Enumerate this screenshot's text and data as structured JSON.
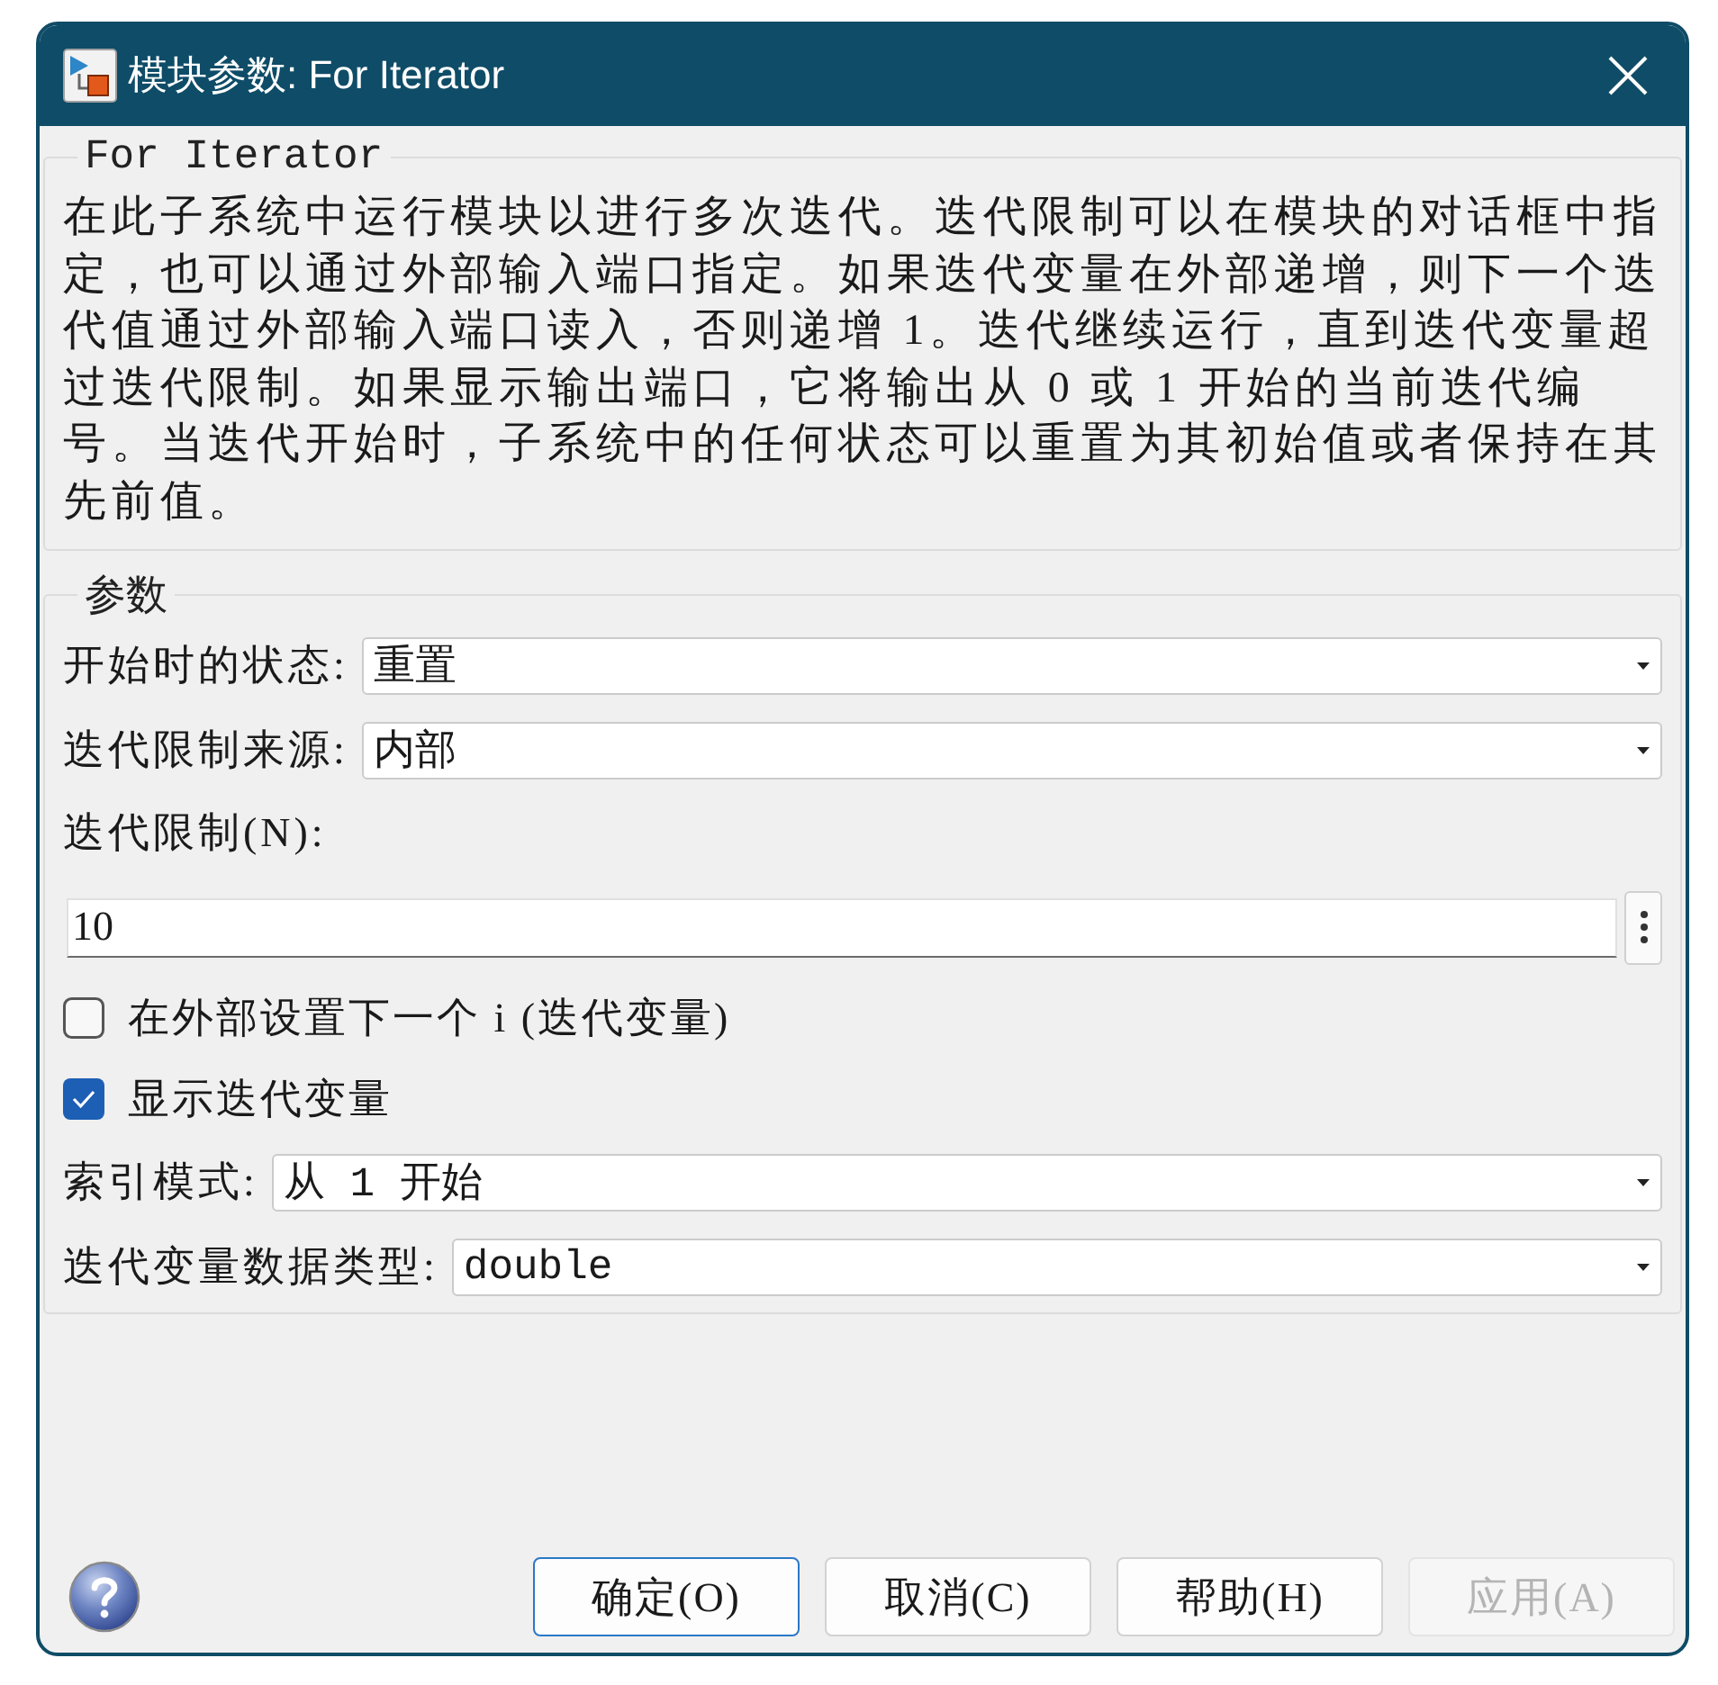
{
  "window": {
    "title": "模块参数: For Iterator"
  },
  "description": {
    "title": "For Iterator",
    "text": "在此子系统中运行模块以进行多次迭代。迭代限制可以在模块的对话框中指定，也可以通过外部输入端口指定。如果迭代变量在外部递增，则下一个迭代值通过外部输入端口读入，否则递增 1。迭代继续运行，直到迭代变量超过迭代限制。如果显示输出端口，它将输出从 0 或 1 开始的当前迭代编号。当迭代开始时，子系统中的任何状态可以重置为其初始值或者保持在其先前值。"
  },
  "parameters": {
    "title": "参数",
    "fields": [
      {
        "kind": "dropdown",
        "label": "开始时的状态:",
        "value": "重置"
      },
      {
        "kind": "dropdown",
        "label": "迭代限制来源:",
        "value": "内部"
      },
      {
        "kind": "text",
        "label": "迭代限制(N):",
        "value": "10"
      },
      {
        "kind": "checkbox",
        "label": "在外部设置下一个 i (迭代变量)",
        "checked": false
      },
      {
        "kind": "checkbox",
        "label": "显示迭代变量",
        "checked": true
      },
      {
        "kind": "dropdown",
        "label": "索引模式:",
        "value": "从 1 开始"
      },
      {
        "kind": "dropdown",
        "label": "迭代变量数据类型:",
        "value": "double"
      }
    ]
  },
  "buttons": [
    {
      "label": "确定(O)",
      "default": true,
      "disabled": false
    },
    {
      "label": "取消(C)",
      "default": false,
      "disabled": false
    },
    {
      "label": "帮助(H)",
      "default": false,
      "disabled": false
    },
    {
      "label": "应用(A)",
      "default": false,
      "disabled": true
    }
  ]
}
